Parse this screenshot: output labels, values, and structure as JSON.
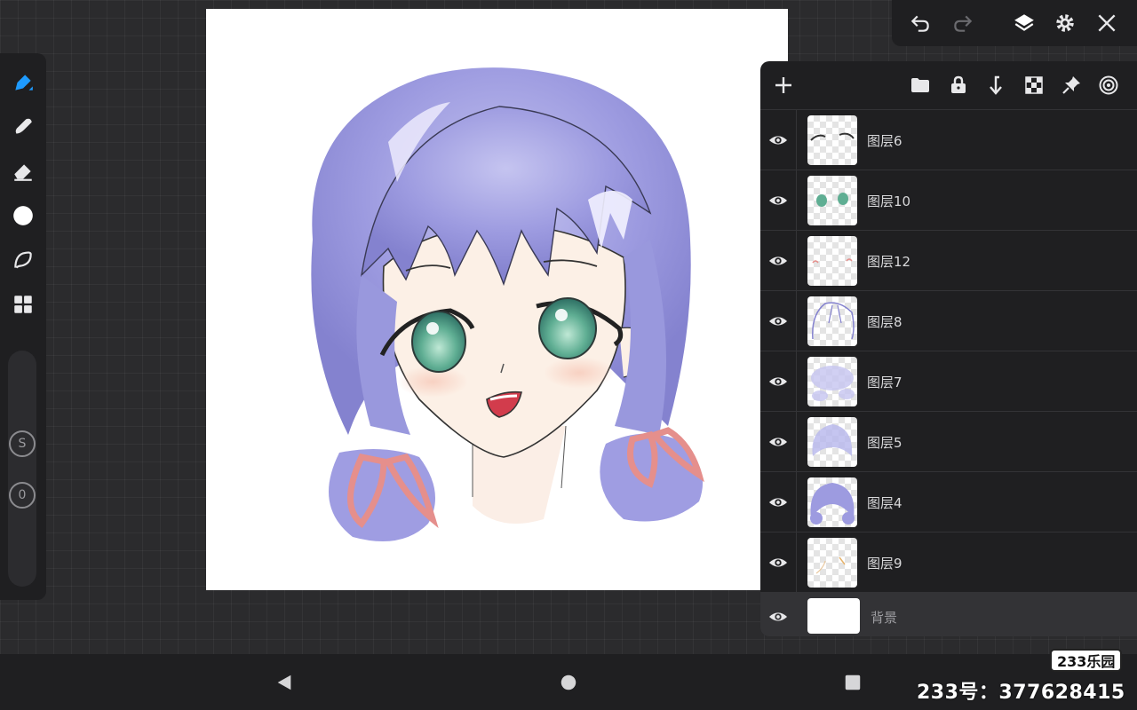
{
  "top_bar": {
    "icons": [
      "undo-icon",
      "redo-icon",
      "layers-icon",
      "gear-icon",
      "close-icon"
    ]
  },
  "left_tools": [
    "pen-icon",
    "smudge-icon",
    "eraser-icon",
    "color-icon",
    "lasso-icon",
    "gallery-icon"
  ],
  "brush_slider": {
    "size_badge": "S",
    "opacity_badge": "0"
  },
  "layers_toolbar": {
    "icons": [
      "add-icon",
      "folder-icon",
      "lock-icon",
      "merge-down-icon",
      "transparency-icon",
      "pin-icon",
      "reference-icon"
    ]
  },
  "layers": [
    {
      "name": "图层6"
    },
    {
      "name": "图层10"
    },
    {
      "name": "图层12"
    },
    {
      "name": "图层8"
    },
    {
      "name": "图层7"
    },
    {
      "name": "图层5"
    },
    {
      "name": "图层4"
    },
    {
      "name": "图层9"
    }
  ],
  "background_layer": {
    "name": "背景"
  },
  "navigation": [
    "back-icon",
    "home-icon",
    "recents-icon"
  ],
  "watermark": {
    "logo": "233乐园",
    "text": "233号：377628415"
  },
  "colors": {
    "app_bg": "#2b2b2d",
    "panel_bg": "#1f1f21",
    "accent": "#1e9bff",
    "hair": "#9b9ce0"
  }
}
